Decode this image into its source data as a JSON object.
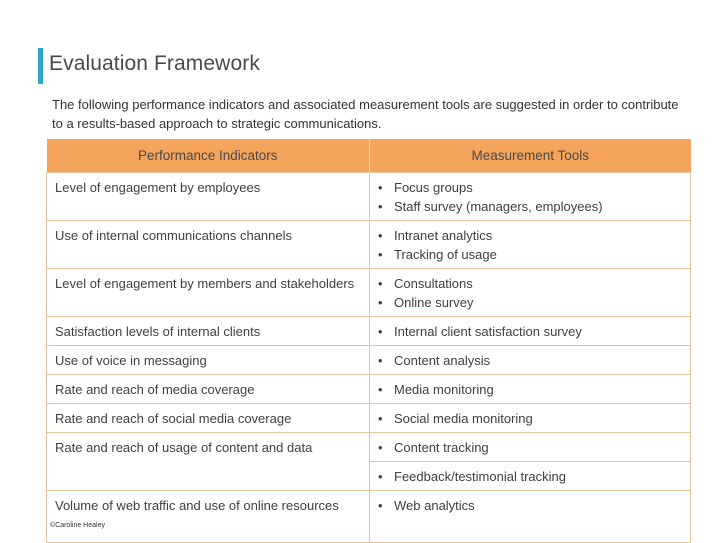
{
  "title": "Evaluation Framework",
  "intro": "The following performance indicators and associated measurement tools are suggested in order to contribute to a results-based approach to strategic communications.",
  "table": {
    "headers": [
      "Performance Indicators",
      "Measurement Tools"
    ],
    "rows": [
      {
        "indicator": "Level of engagement by employees",
        "tools": [
          "Focus groups",
          "Staff survey (managers, employees)"
        ]
      },
      {
        "indicator": "Use of internal communications channels",
        "tools": [
          "Intranet analytics",
          "Tracking of usage"
        ]
      },
      {
        "indicator": "Level of engagement by members and stakeholders",
        "tools": [
          "Consultations",
          "Online survey"
        ]
      },
      {
        "indicator": "Satisfaction levels of internal clients",
        "tools": [
          "Internal client satisfaction survey"
        ]
      },
      {
        "indicator": "Use of voice in messaging",
        "tools": [
          "Content analysis"
        ]
      },
      {
        "indicator": "Rate and reach of media coverage",
        "tools": [
          "Media monitoring"
        ]
      },
      {
        "indicator": "Rate and reach of social media coverage",
        "tools": [
          "Social media monitoring"
        ]
      },
      {
        "indicator": "Rate and reach of usage of content and data",
        "tools": [
          "Content tracking"
        ]
      },
      {
        "indicator": "",
        "tools": [
          "Feedback/testimonial tracking"
        ]
      },
      {
        "indicator": "Volume of web traffic and use of online resources",
        "tools": [
          "Web analytics"
        ]
      }
    ],
    "bullet": "•"
  },
  "footer": "©Caroline Healey",
  "colors": {
    "accent_bar": "#2ea3d2",
    "header_bg": "#f5a45b",
    "border": "#e3c59e"
  }
}
